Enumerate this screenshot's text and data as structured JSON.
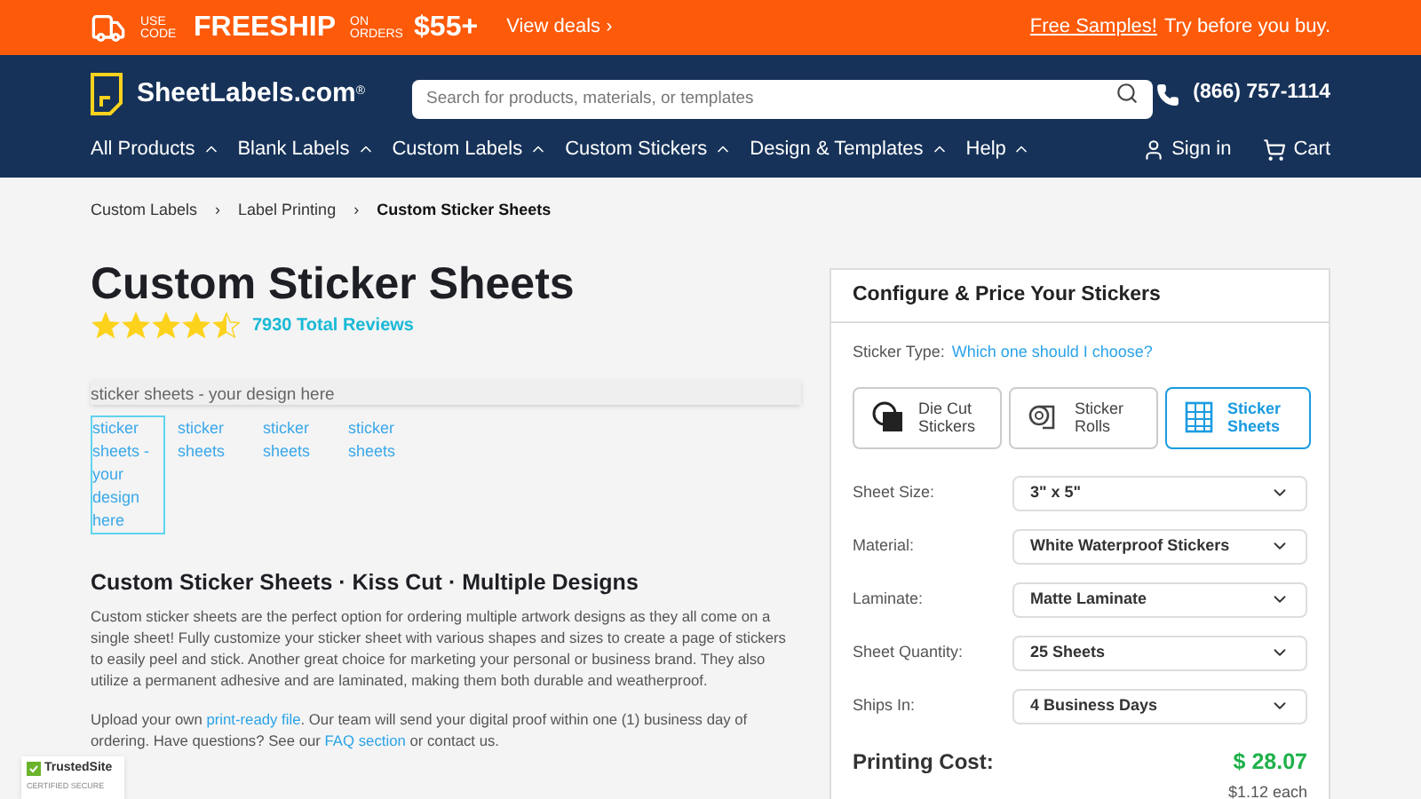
{
  "promo_bar": {
    "use_code": "USE CODE",
    "code": "FREESHIP",
    "on_orders": "ON ORDERS",
    "amount": "$55+",
    "deals_link": "View deals ›",
    "samples_link": "Free Samples!",
    "samples_text": "Try before you buy."
  },
  "header": {
    "logo": "SheetLabels.com",
    "logo_mark": "®",
    "search": {
      "placeholder": "Search for products, materials, or templates"
    },
    "phone": "(866) 757-1114"
  },
  "nav": {
    "items": [
      "All Products",
      "Blank Labels",
      "Custom Labels",
      "Custom Stickers",
      "Design & Templates",
      "Help"
    ],
    "sign_in": "Sign in",
    "cart": "Cart"
  },
  "breadcrumbs": [
    {
      "label": "Custom Labels",
      "current": false
    },
    {
      "label": "Label Printing",
      "current": false
    },
    {
      "label": "Custom Sticker Sheets",
      "current": true
    }
  ],
  "breadcrumb_separator": "›",
  "product": {
    "title": "Custom Sticker Sheets",
    "stars": 4.5,
    "reviews": "7930 Total Reviews"
  },
  "main_image_alt": "sticker sheets - your design here",
  "thumbnails": [
    {
      "label": "sticker sheets - your design here",
      "selected": true
    },
    {
      "label": "sticker sheets",
      "selected": false
    },
    {
      "label": "sticker sheets",
      "selected": false
    },
    {
      "label": "sticker sheets",
      "selected": false
    }
  ],
  "description": {
    "heading": "Custom Sticker Sheets · Kiss Cut · Multiple Designs",
    "paragraph": "Custom sticker sheets are the perfect option for ordering multiple artwork designs as they all come on a single sheet! Fully customize your sticker sheet with various shapes and sizes to create a page of stickers to easily peel and stick. Another great choice for marketing your personal or business brand. They also utilize a permanent adhesive and are laminated, making them both durable and weatherproof.",
    "upload": [
      {
        "kind": "text",
        "text": "Upload your own "
      },
      {
        "kind": "link",
        "text": "print-ready file"
      },
      {
        "kind": "text",
        "text": ". Our team will send your digital proof within one (1) business day of ordering. Have questions? See our "
      },
      {
        "kind": "link",
        "text": "FAQ section"
      },
      {
        "kind": "text",
        "text": " or contact us."
      }
    ]
  },
  "trust_badge": {
    "name": "TrustedSite",
    "sub": "CERTIFIED SECURE"
  },
  "configurator": {
    "title": "Configure & Price Your Stickers",
    "type_label": "Sticker Type:",
    "type_help": "Which one should I choose?",
    "types": [
      {
        "kind": "diecut",
        "label": "Die Cut Stickers",
        "selected": false
      },
      {
        "kind": "roll",
        "label": "Sticker Rolls",
        "selected": false
      },
      {
        "kind": "sheet",
        "label": "Sticker Sheets",
        "selected": true
      }
    ],
    "options": [
      {
        "label": "Sheet Size:",
        "value": "3\" x 5\""
      },
      {
        "label": "Material:",
        "value": "White Waterproof Stickers"
      },
      {
        "label": "Laminate:",
        "value": "Matte Laminate"
      },
      {
        "label": "Sheet Quantity:",
        "value": "25 Sheets"
      },
      {
        "label": "Ships In:",
        "value": "4 Business Days"
      }
    ],
    "cost_label": "Printing Cost:",
    "cost": "$ 28.07",
    "each": "$1.12 each"
  }
}
